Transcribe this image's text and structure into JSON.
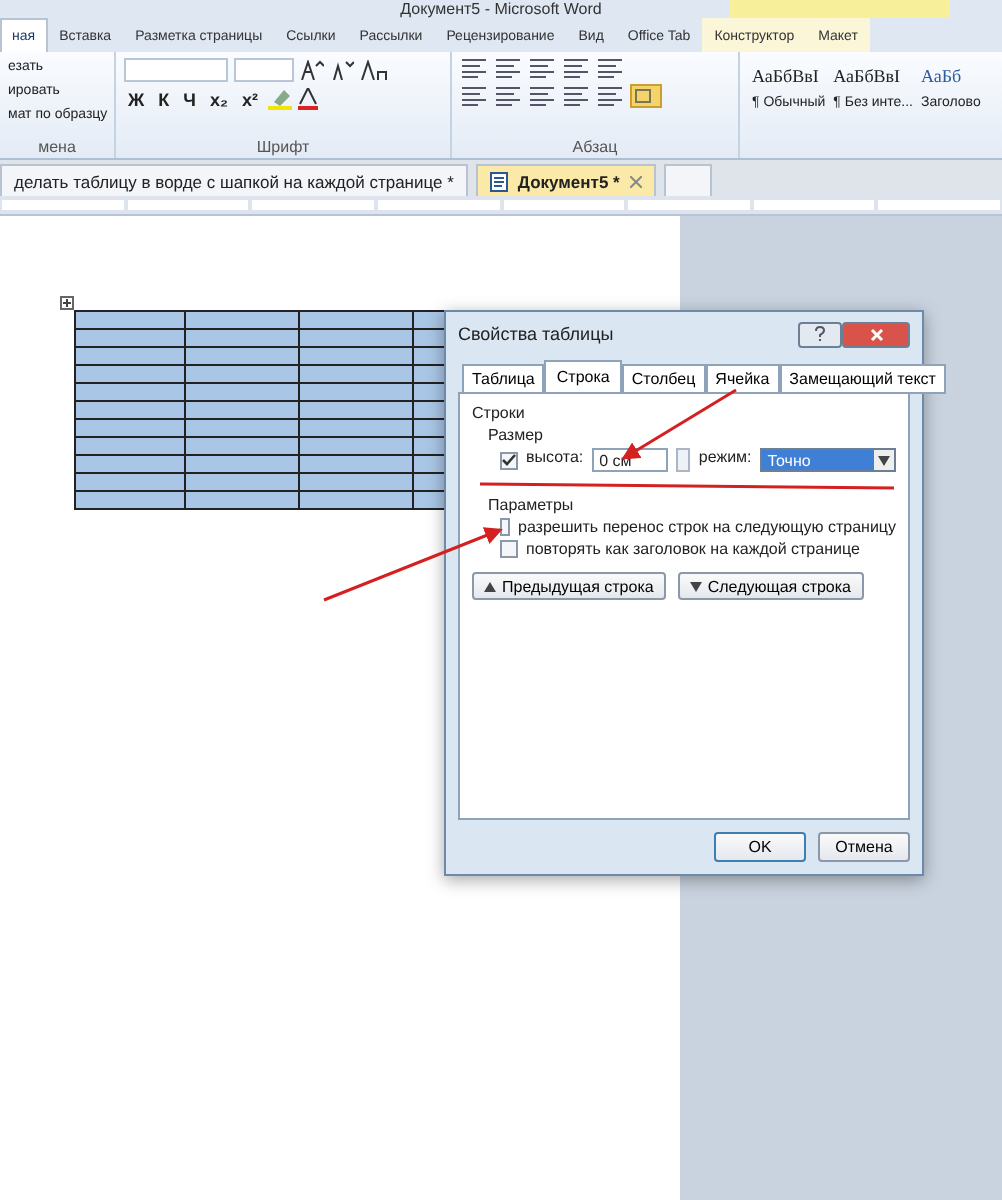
{
  "window": {
    "title": "Документ5 - Microsoft Word"
  },
  "ribbon_tabs": [
    {
      "label": "ная",
      "selected": true
    },
    {
      "label": "Вставка",
      "selected": false
    },
    {
      "label": "Разметка страницы",
      "selected": false
    },
    {
      "label": "Ссылки",
      "selected": false
    },
    {
      "label": "Рассылки",
      "selected": false
    },
    {
      "label": "Рецензирование",
      "selected": false
    },
    {
      "label": "Вид",
      "selected": false
    },
    {
      "label": "Office Tab",
      "selected": false
    },
    {
      "label": "Конструктор",
      "selected": false,
      "contextual": true
    },
    {
      "label": "Макет",
      "selected": false,
      "contextual": true
    }
  ],
  "ribbon": {
    "clipboard": {
      "items": [
        "езать",
        "ировать",
        "мат по образцу"
      ],
      "label": "мена"
    },
    "font": {
      "label": "Шрифт",
      "buttons": [
        "Ж",
        "К",
        "Ч",
        "x₂",
        "x²"
      ]
    },
    "paragraph": {
      "label": "Абзац"
    },
    "styles": [
      {
        "sample": "АаБбВвI",
        "name": "¶ Обычный"
      },
      {
        "sample": "АаБбВвI",
        "name": "¶ Без инте..."
      },
      {
        "sample": "АаБб",
        "name": "Заголово"
      }
    ]
  },
  "document_tabs": [
    {
      "label": "делать таблицу в ворде с шапкой на каждой странице *",
      "selected": false
    },
    {
      "label": "Документ5 *",
      "selected": true,
      "closable": true
    }
  ],
  "dialog": {
    "title": "Свойства таблицы",
    "tabs": [
      {
        "label": "Таблица",
        "selected": false
      },
      {
        "label": "Строка",
        "selected": true
      },
      {
        "label": "Столбец",
        "selected": false
      },
      {
        "label": "Ячейка",
        "selected": false
      },
      {
        "label": "Замещающий текст",
        "selected": false
      }
    ],
    "section": "Строки",
    "size_group": "Размер",
    "height": {
      "label": "высота:",
      "checked": true,
      "value": "0 см"
    },
    "mode": {
      "label": "режим:",
      "value": "Точно"
    },
    "options_group": "Параметры",
    "options": [
      {
        "label": "разрешить перенос строк на следующую страницу",
        "checked": false
      },
      {
        "label": "повторять как заголовок на каждой странице",
        "checked": false
      }
    ],
    "nav_buttons": [
      "Предыдущая строка",
      "Следующая строка"
    ],
    "buttons": [
      "OK",
      "Отмена"
    ]
  }
}
